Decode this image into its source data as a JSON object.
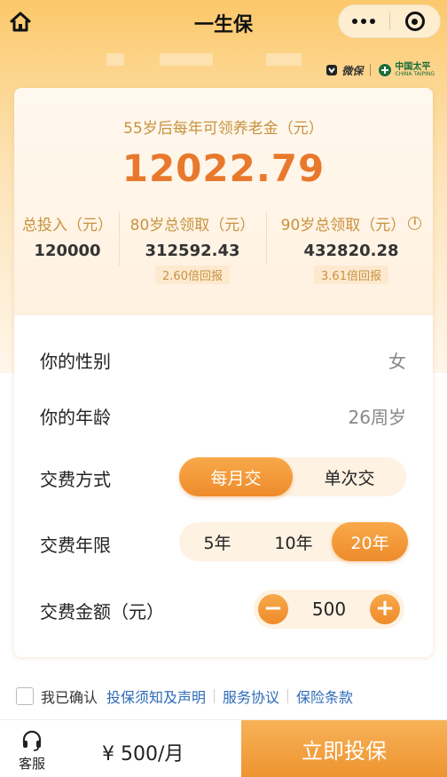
{
  "nav": {
    "title": "一生保"
  },
  "brands": {
    "weibao": "微保",
    "cntp_cn": "中国太平",
    "cntp_en": "CHINA TAIPING"
  },
  "summary": {
    "headline": "55岁后每年可领养老金（元）",
    "amount": "12022.79",
    "stats": [
      {
        "label": "总投入（元）",
        "value": "120000"
      },
      {
        "label": "80岁总领取（元）",
        "value": "312592.43",
        "ratio": "2.60倍回报"
      },
      {
        "label": "90岁总领取（元）",
        "value": "432820.28",
        "ratio": "3.61倍回报"
      }
    ]
  },
  "form": {
    "gender": {
      "label": "你的性别",
      "value": "女"
    },
    "age": {
      "label": "你的年龄",
      "value": "26周岁"
    },
    "pay_method": {
      "label": "交费方式",
      "options": [
        "每月交",
        "单次交"
      ],
      "selected": "每月交"
    },
    "pay_years": {
      "label": "交费年限",
      "options": [
        "5年",
        "10年",
        "20年"
      ],
      "selected": "20年"
    },
    "pay_amount": {
      "label": "交费金额（元）",
      "value": "500",
      "minus": "−",
      "plus": "+"
    }
  },
  "agreement": {
    "confirm": "我已确认",
    "links": [
      "投保须知及声明",
      "服务协议",
      "保险条款"
    ]
  },
  "footer": {
    "service_label": "客服",
    "price": "¥ 500/月",
    "buy_label": "立即投保"
  },
  "colors": {
    "accent": "#ee8b2b",
    "gold_text": "#c8923e",
    "link": "#2e6bb8"
  }
}
